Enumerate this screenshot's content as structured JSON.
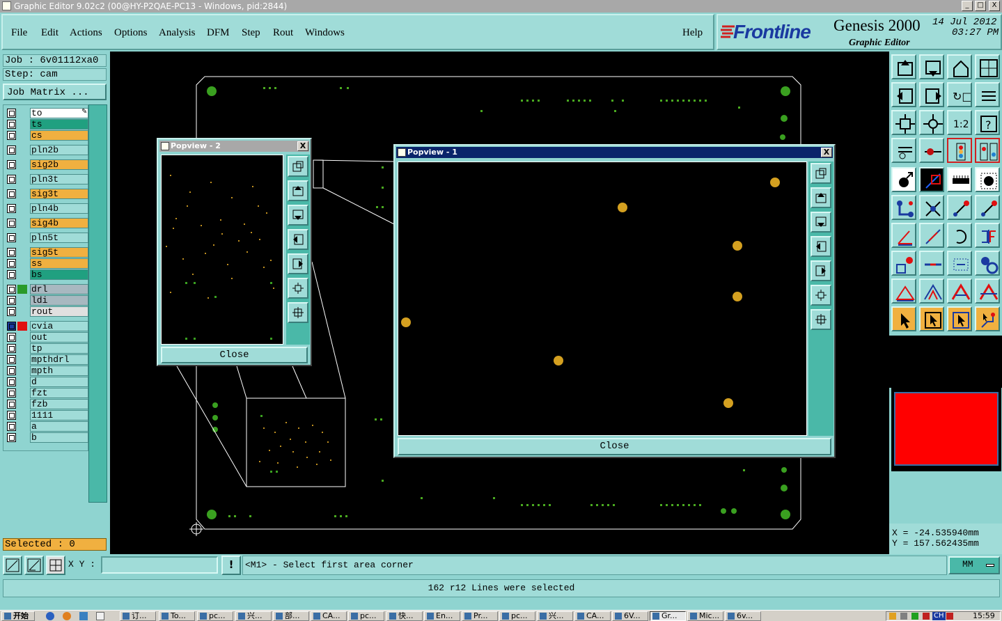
{
  "window": {
    "title": "Graphic Editor 9.02c2 (00@HY-P2QAE-PC13 - Windows, pid:2844)",
    "min": "_",
    "max": "□",
    "close": "X"
  },
  "menu": {
    "file": "File",
    "edit": "Edit",
    "actions": "Actions",
    "options": "Options",
    "analysis": "Analysis",
    "dfm": "DFM",
    "step": "Step",
    "rout": "Rout",
    "windows": "Windows",
    "help": "Help"
  },
  "brand": {
    "logo": "Frontline",
    "product": "Genesis 2000",
    "subtitle": "Graphic Editor",
    "date": "14 Jul 2012",
    "time": "03:27 PM"
  },
  "job": {
    "job_label": "Job : 6v01112xa0",
    "step_label": "Step: cam",
    "matrix_button": "Job Matrix ..."
  },
  "layers": [
    {
      "name": "to",
      "color": "#ffffff"
    },
    {
      "name": "ts",
      "color": "#20a080"
    },
    {
      "name": "cs",
      "color": "#f0b040"
    },
    {
      "name": "pln2b",
      "color": "#a0dcd8"
    },
    {
      "name": "sig2b",
      "color": "#f0b040"
    },
    {
      "name": "pln3t",
      "color": "#a0dcd8"
    },
    {
      "name": "sig3t",
      "color": "#f0b040"
    },
    {
      "name": "pln4b",
      "color": "#a0dcd8"
    },
    {
      "name": "sig4b",
      "color": "#f0b040"
    },
    {
      "name": "pln5t",
      "color": "#a0dcd8"
    },
    {
      "name": "sig5t",
      "color": "#f0b040"
    },
    {
      "name": "ss",
      "color": "#f0b040"
    },
    {
      "name": "bs",
      "color": "#20a080"
    },
    {
      "name": "drl",
      "color": "#a8b8c0"
    },
    {
      "name": "ldi",
      "color": "#a8b8c0"
    },
    {
      "name": "rout",
      "color": "#e0e0e0"
    },
    {
      "name": "cvia",
      "color": "#a0dcd8"
    },
    {
      "name": "out",
      "color": "#a0dcd8"
    },
    {
      "name": "tp",
      "color": "#a0dcd8"
    },
    {
      "name": "mpthdrl",
      "color": "#a0dcd8"
    },
    {
      "name": "mpth",
      "color": "#a0dcd8"
    },
    {
      "name": "d",
      "color": "#a0dcd8"
    },
    {
      "name": "fzt",
      "color": "#a0dcd8"
    },
    {
      "name": "fzb",
      "color": "#a0dcd8"
    },
    {
      "name": "1111",
      "color": "#a0dcd8"
    },
    {
      "name": "a",
      "color": "#a0dcd8"
    },
    {
      "name": "b",
      "color": "#a0dcd8"
    }
  ],
  "selected": "Selected : 0",
  "popview2": {
    "title": "Popview - 2",
    "close": "Close",
    "x": "X"
  },
  "popview1": {
    "title": "Popview - 1",
    "close": "Close",
    "x": "X"
  },
  "coords": {
    "x": "X  = -24.535940mm",
    "y": "Y  = 157.562435mm"
  },
  "status": {
    "xy_label": "X Y :",
    "xy_value": "",
    "excl": "!",
    "prompt": "<M1> - Select first area corner",
    "units": "MM",
    "message": "162 r12 Lines were selected"
  },
  "taskbar": {
    "start": "开始",
    "items": [
      "订...",
      "To...",
      "pc...",
      "兴...",
      "部...",
      "CA...",
      "pc...",
      "快...",
      "En...",
      "Pr...",
      "pc...",
      "兴...",
      "CA...",
      "6V...",
      "Gr...",
      "Mic...",
      "6v..."
    ],
    "lang": "CH",
    "clock": "15:59"
  },
  "colors": {
    "accent": "#a0dcd8",
    "pad_green": "#3aa020",
    "pad_yellow": "#d4a020",
    "board_outline": "#ffffff",
    "popup_active": "#0a246a"
  }
}
